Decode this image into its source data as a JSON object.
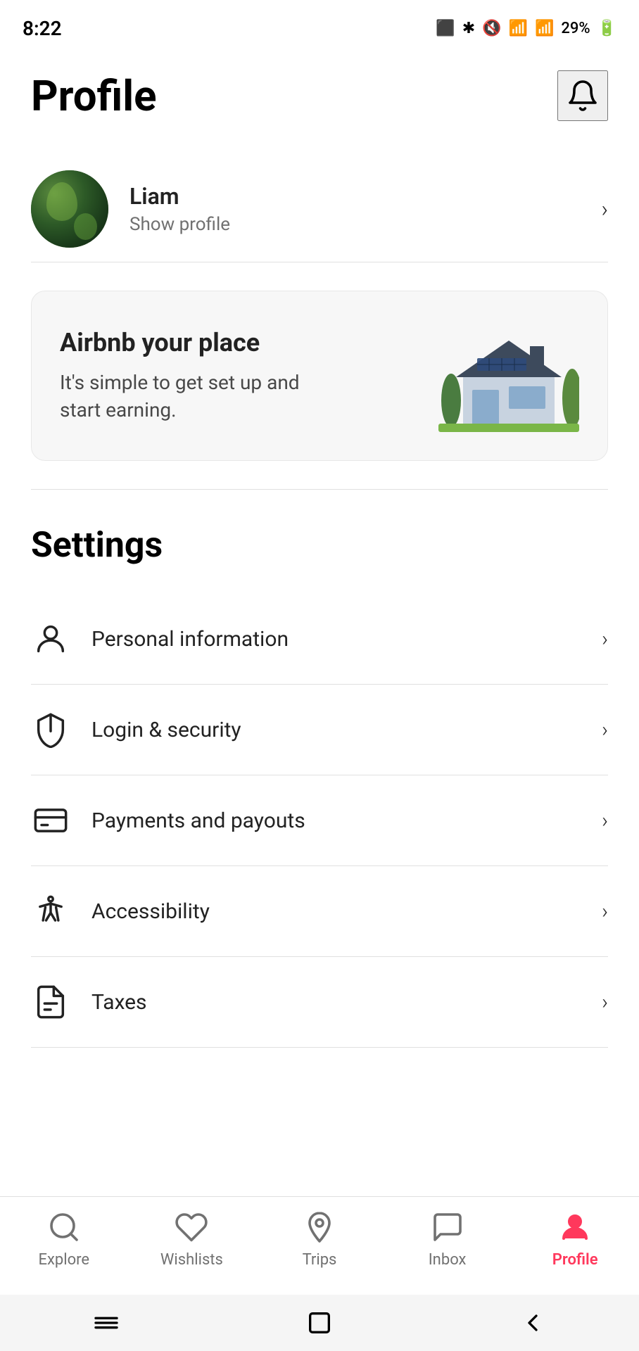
{
  "statusBar": {
    "time": "8:22",
    "battery": "29%"
  },
  "page": {
    "title": "Profile",
    "notificationButton": "notifications"
  },
  "user": {
    "name": "Liam",
    "showProfileLabel": "Show profile"
  },
  "banner": {
    "title": "Airbnb your place",
    "subtitle": "It's simple to get set up and\nstart earning."
  },
  "settings": {
    "title": "Settings",
    "items": [
      {
        "id": "personal-information",
        "label": "Personal information",
        "icon": "person"
      },
      {
        "id": "login-security",
        "label": "Login & security",
        "icon": "shield"
      },
      {
        "id": "payments-payouts",
        "label": "Payments and payouts",
        "icon": "payment"
      },
      {
        "id": "accessibility",
        "label": "Accessibility",
        "icon": "accessibility"
      },
      {
        "id": "taxes",
        "label": "Taxes",
        "icon": "document"
      }
    ]
  },
  "bottomNav": {
    "items": [
      {
        "id": "explore",
        "label": "Explore",
        "active": false
      },
      {
        "id": "wishlists",
        "label": "Wishlists",
        "active": false
      },
      {
        "id": "trips",
        "label": "Trips",
        "active": false
      },
      {
        "id": "inbox",
        "label": "Inbox",
        "active": false
      },
      {
        "id": "profile",
        "label": "Profile",
        "active": true
      }
    ]
  }
}
